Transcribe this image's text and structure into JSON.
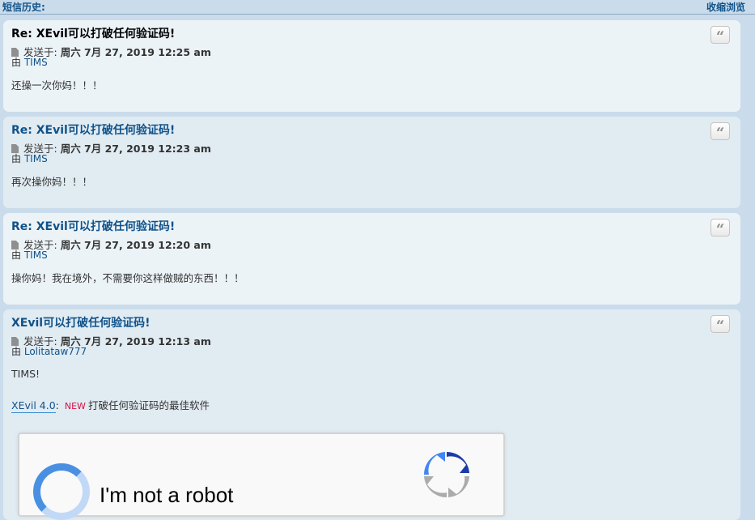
{
  "header": {
    "history_label": "短信历史:",
    "collapse_label": "收缩浏览"
  },
  "posts": [
    {
      "title": "Re: XEvil可以打破任何验证码!",
      "sent_label": "发送于:",
      "date": "周六 7月 27, 2019 12:25 am",
      "by_label": "由",
      "author": "TIMS",
      "body": "还操一次你妈！！！"
    },
    {
      "title": "Re: XEvil可以打破任何验证码!",
      "sent_label": "发送于:",
      "date": "周六 7月 27, 2019 12:23 am",
      "by_label": "由",
      "author": "TIMS",
      "body": "再次操你妈！！！"
    },
    {
      "title": "Re: XEvil可以打破任何验证码!",
      "sent_label": "发送于:",
      "date": "周六 7月 27, 2019 12:20 am",
      "by_label": "由",
      "author": "TIMS",
      "body": "操你妈！我在境外，不需要你这样做贼的东西！！！"
    },
    {
      "title": "XEvil可以打破任何验证码!",
      "sent_label": "发送于:",
      "date": "周六 7月 27, 2019 12:13 am",
      "by_label": "由",
      "author": "Lolitataw777",
      "body": "TIMS!",
      "link_text": "XEvil 4.0",
      "link_colon": ":",
      "new_badge": "NEW",
      "link_desc": "打破任何验证码的最佳软件",
      "captcha_label": "I'm not a robot"
    }
  ],
  "quote_icon": "quote-icon",
  "document_icon": "document-icon",
  "colors": {
    "link": "#105289",
    "new_badge": "#d31141",
    "post_bg_light": "#ecf3f7",
    "post_bg_dark": "#e1ebf2"
  }
}
